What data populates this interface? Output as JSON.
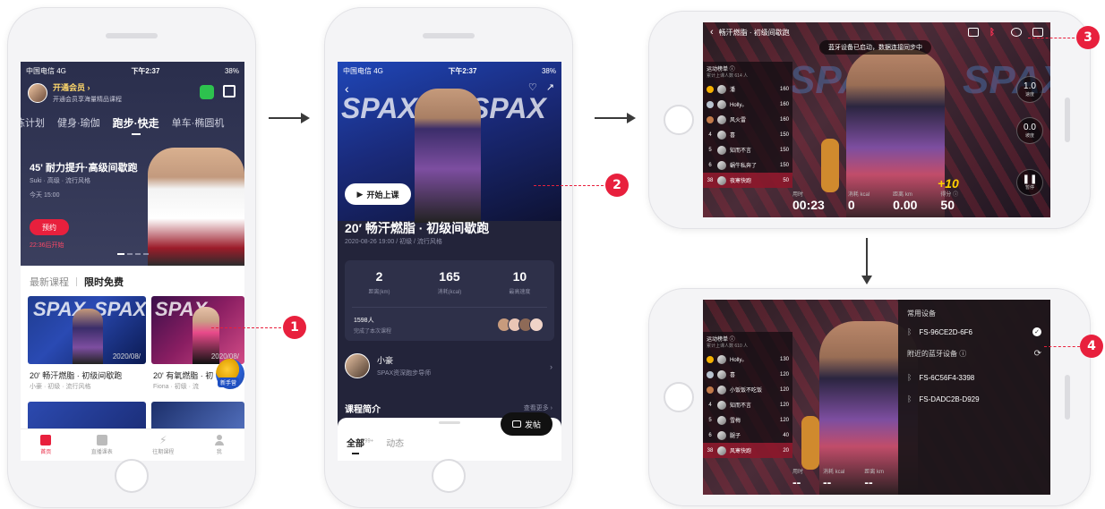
{
  "status_bar": {
    "carrier": "中国电信",
    "network": "4G",
    "time": "下午2:37",
    "battery": "38%"
  },
  "screen1": {
    "member_title": "开通会员 ›",
    "member_sub": "开通会员享海量精品课程",
    "tabs": [
      "练计划",
      "健身·瑜伽",
      "跑步·快走",
      "单车·椭圆机"
    ],
    "active_tab": "跑步·快走",
    "hero_title": "45' 耐力提升·高级间歇跑",
    "hero_sub": "Suki · 高级 · 流行风格",
    "hero_time": "今天  15:00",
    "reserve_label": "预约",
    "countdown": "22:36后开始",
    "section_latest": "最新课程",
    "section_free": "限时免费",
    "thumb_brand": "SPAX",
    "thumb2_date": "2020/08/",
    "thumb1_date": "2020/08/",
    "course1_title": "20' 畅汗燃脂 · 初级间歇跑",
    "course1_meta": "小豪 · 初级 · 流行风格",
    "course2_title": "20' 有氧燃脂 · 初",
    "course2_meta": "Fiona · 初级 · 流",
    "badge_new": "新手营",
    "tabbar": [
      "首页",
      "直播课表",
      "往期课程",
      "我"
    ]
  },
  "screen2": {
    "brand": "SPAX",
    "start_label": "开始上课",
    "title": "20′ 畅汗燃脂 · 初级间歇跑",
    "meta": "2020-08-26 19:00 / 初级 / 流行风格",
    "stats": [
      {
        "value": "2",
        "label": "距离(km)"
      },
      {
        "value": "165",
        "label": "消耗(kcal)"
      },
      {
        "value": "10",
        "label": "最高速度"
      }
    ],
    "participants": "1598人",
    "participants_sub": "完成了本次课程",
    "coach_name": "小豪",
    "coach_desc": "SPAX资深跑步导师",
    "intro_label": "课程简介",
    "more_label": "查看更多 ›",
    "tab_all": "全部",
    "tab_all_count": "99+",
    "tab_feed": "动态",
    "post_label": "发帖"
  },
  "screen3": {
    "title": "畅汗燃脂 · 初级间歇跑",
    "toast": "蓝牙设备已启动，数据连接同步中",
    "board_title": "运动榜单 ⓘ",
    "board_sub": "累计上课人数 614 人",
    "ranks": [
      {
        "rank": "1",
        "name": "潘",
        "score": "160"
      },
      {
        "rank": "2",
        "name": "Holly。",
        "score": "160"
      },
      {
        "rank": "3",
        "name": "风火雷",
        "score": "160"
      },
      {
        "rank": "4",
        "name": "喜",
        "score": "150"
      },
      {
        "rank": "5",
        "name": "知而不言",
        "score": "150"
      },
      {
        "rank": "6",
        "name": "蜗牛私奔了",
        "score": "150"
      },
      {
        "rank": "38",
        "name": "夜寒快跑",
        "score": "50"
      }
    ],
    "speed_value": "1.0",
    "speed_label": "速度",
    "incline_value": "0.0",
    "incline_label": "坡度",
    "pause_label": "暂停",
    "plus": "+10",
    "stats": [
      {
        "label": "用时",
        "value": "00:23"
      },
      {
        "label": "消耗 kcal",
        "value": "0"
      },
      {
        "label": "距离 km",
        "value": "0.00"
      },
      {
        "label": "得分 ⓘ",
        "value": "50"
      }
    ]
  },
  "screen4": {
    "board_title": "运动榜单 ⓘ",
    "board_sub": "累计上课人数 610 人",
    "ranks": [
      {
        "rank": "1",
        "name": "Holly。",
        "score": "130"
      },
      {
        "rank": "2",
        "name": "喜",
        "score": "120"
      },
      {
        "rank": "3",
        "name": "小饭饭不吃饭",
        "score": "120"
      },
      {
        "rank": "4",
        "name": "知而不言",
        "score": "120"
      },
      {
        "rank": "5",
        "name": "雪梅",
        "score": "120"
      },
      {
        "rank": "6",
        "name": "腿子",
        "score": "40"
      },
      {
        "rank": "38",
        "name": "风寒快跑",
        "score": "20"
      }
    ],
    "common_devices": "常用设备",
    "device_connected": "FS-96CE2D-6F6",
    "nearby_devices": "附近的蓝牙设备 ⓘ",
    "device_a": "FS-6C56F4-3398",
    "device_b": "FS-DADC2B-D929",
    "stat_labels": [
      "用时",
      "消耗 kcal",
      "距离 km"
    ],
    "stat_dash": "--"
  },
  "markers": [
    "1",
    "2",
    "3",
    "4"
  ],
  "colors": {
    "accent": "#e8203d",
    "dark_bg": "#23243a"
  }
}
